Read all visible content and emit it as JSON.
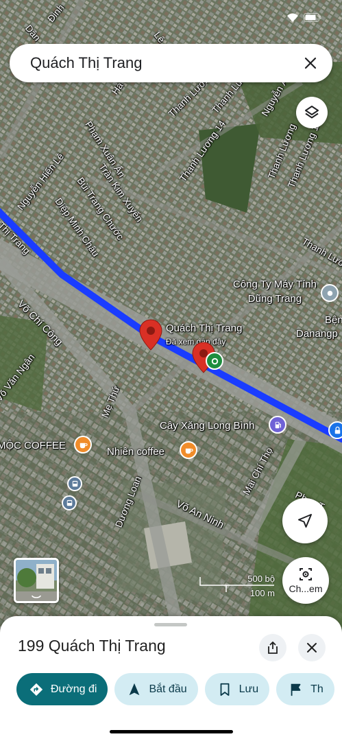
{
  "status_bar": {
    "time": "",
    "icons": [
      "wifi-icon",
      "battery-icon"
    ]
  },
  "search": {
    "query": "Quách Thị Trang"
  },
  "map": {
    "streets": [
      {
        "name": "Hà Bổng"
      },
      {
        "name": "Phạm Xuân Ẩn"
      },
      {
        "name": "Thanh Lương"
      },
      {
        "name": "Thanh Lương"
      },
      {
        "name": "Nguyễn Ánh"
      },
      {
        "name": "Thanh Lương 14"
      },
      {
        "name": "Thanh Lương 10"
      },
      {
        "name": "Thanh Lương"
      },
      {
        "name": "Thanh Lươn"
      },
      {
        "name": "Nguyễn Hiến Lê"
      },
      {
        "name": "Bùi Trang Chước"
      },
      {
        "name": "Trần Kim Xuyến"
      },
      {
        "name": "Diệp Minh Châu"
      },
      {
        "name": "Thị Trang"
      },
      {
        "name": "Võ Chí Công"
      },
      {
        "name": "Võ Văn Ngân"
      },
      {
        "name": "Mẹ Thứ"
      },
      {
        "name": "Võ An Ninh"
      },
      {
        "name": "Dương Loan"
      },
      {
        "name": "Mai Chí Thọ"
      },
      {
        "name": "Phan T"
      },
      {
        "name": "Lê"
      },
      {
        "name": "Đinh"
      },
      {
        "name": "Dân"
      }
    ],
    "places": {
      "company": "Công Ty Máy Tính Dũng Trang",
      "hospital_partial": "Bện",
      "danang_partial": "Danangp",
      "destination": "Quách Thị Trang",
      "destination_sub": "Đã xem gần đây",
      "gas_station": "Cây Xăng Long Bình",
      "moc_coffee": "MỘC COFFEE",
      "nhien_coffee": "Nhiên coffee"
    },
    "scale": {
      "top": "500 bộ",
      "bottom": "100 m"
    },
    "route_color": "#1a3cff",
    "pin_color": "#d93025"
  },
  "controls": {
    "layers_icon": "layers-icon",
    "locate_icon": "navigation-arrow-icon",
    "lens_label": "Ch...em"
  },
  "sheet": {
    "title": "199 Quách Thị Trang",
    "actions": [
      {
        "label": "Đường đi",
        "icon": "directions-icon"
      },
      {
        "label": "Bắt đầu",
        "icon": "navigation-icon"
      },
      {
        "label": "Lưu",
        "icon": "bookmark-icon"
      },
      {
        "label": "Th",
        "icon": "flag-icon"
      }
    ]
  }
}
